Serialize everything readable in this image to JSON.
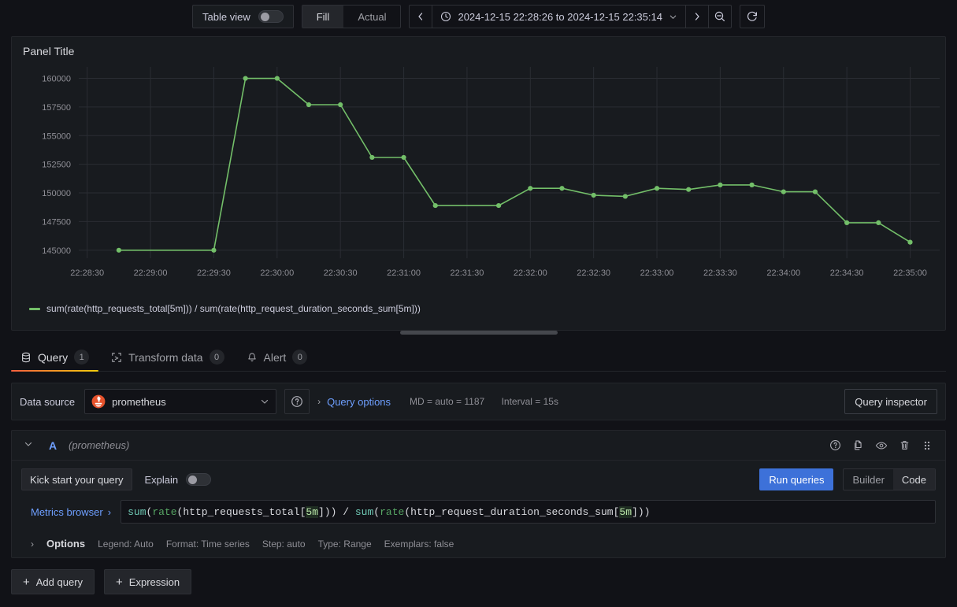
{
  "toolbar": {
    "table_view_label": "Table view",
    "table_view_on": false,
    "fill_label": "Fill",
    "actual_label": "Actual",
    "time_range": "2024-12-15 22:28:26 to 2024-12-15 22:35:14",
    "prev_icon": "chevron-left-icon",
    "next_icon": "chevron-right-icon",
    "clock_icon": "clock-icon",
    "zoom_out_icon": "zoom-out-icon",
    "refresh_icon": "refresh-icon"
  },
  "panel": {
    "title": "Panel Title",
    "legend": "sum(rate(http_requests_total[5m])) / sum(rate(http_request_duration_seconds_sum[5m]))",
    "series_color": "#73bf69"
  },
  "chart_data": {
    "type": "line",
    "title": "Panel Title",
    "xlabel": "",
    "ylabel": "",
    "ylim": [
      144300,
      161000
    ],
    "yticks": [
      145000,
      147500,
      150000,
      152500,
      155000,
      157500,
      160000
    ],
    "xticks": [
      "22:28:30",
      "22:29:00",
      "22:29:30",
      "22:30:00",
      "22:30:30",
      "22:31:00",
      "22:31:30",
      "22:32:00",
      "22:32:30",
      "22:33:00",
      "22:33:30",
      "22:34:00",
      "22:34:30",
      "22:35:00"
    ],
    "grid": true,
    "legend_position": "bottom",
    "series": [
      {
        "name": "sum(rate(http_requests_total[5m])) / sum(rate(http_request_duration_seconds_sum[5m]))",
        "color": "#73bf69",
        "x": [
          "22:28:45",
          "22:29:30",
          "22:29:45",
          "22:30:00",
          "22:30:15",
          "22:30:30",
          "22:30:45",
          "22:31:00",
          "22:31:15",
          "22:31:45",
          "22:32:00",
          "22:32:15",
          "22:32:30",
          "22:32:45",
          "22:33:00",
          "22:33:15",
          "22:33:30",
          "22:33:45",
          "22:34:00",
          "22:34:15",
          "22:34:30",
          "22:34:45",
          "22:35:00"
        ],
        "values": [
          145000,
          145000,
          160000,
          160000,
          157700,
          157700,
          153100,
          153100,
          148900,
          148900,
          150400,
          150400,
          149800,
          149700,
          150400,
          150300,
          150700,
          150700,
          150100,
          150100,
          147400,
          147400,
          145700,
          145700
        ]
      }
    ]
  },
  "tabs": [
    {
      "label": "Query",
      "badge": "1",
      "icon": "database-icon",
      "active": true
    },
    {
      "label": "Transform data",
      "badge": "0",
      "icon": "transform-icon",
      "active": false
    },
    {
      "label": "Alert",
      "badge": "0",
      "icon": "bell-icon",
      "active": false
    }
  ],
  "datasource": {
    "label": "Data source",
    "selected": "prometheus",
    "help_icon": "question-circle-icon",
    "chevron_icon": "chevron-down-icon",
    "query_options_label": "Query options",
    "meta_md": "MD = auto = 1187",
    "meta_interval": "Interval = 15s",
    "query_inspector_label": "Query inspector"
  },
  "query_row": {
    "ref_id": "A",
    "datasource_hint": "(prometheus)",
    "kick_start_label": "Kick start your query",
    "explain_label": "Explain",
    "explain_on": false,
    "run_queries_label": "Run queries",
    "builder_label": "Builder",
    "code_label": "Code",
    "editor_mode": "Code",
    "metrics_browser_label": "Metrics browser",
    "expression": "sum(rate(http_requests_total[5m])) / sum(rate(http_request_duration_seconds_sum[5m]))",
    "icons": [
      "question-circle-icon",
      "copy-icon",
      "eye-icon",
      "trash-icon",
      "drag-handle-icon"
    ],
    "options": {
      "title": "Options",
      "items": [
        "Legend: Auto",
        "Format: Time series",
        "Step: auto",
        "Type: Range",
        "Exemplars: false"
      ]
    }
  },
  "bottom": {
    "add_query_label": "Add query",
    "expression_label": "Expression"
  }
}
